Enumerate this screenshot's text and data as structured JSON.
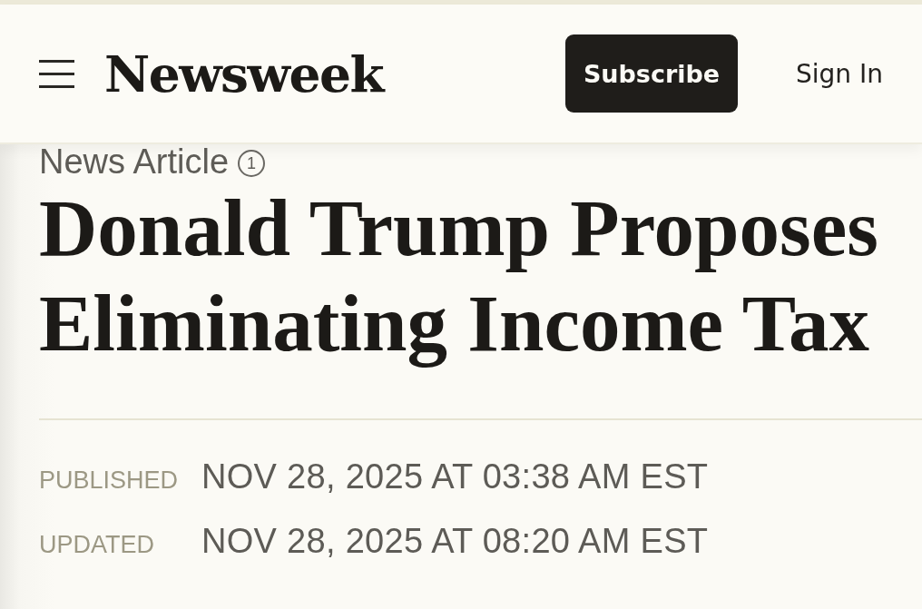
{
  "header": {
    "logo": "Newsweek",
    "subscribe_button": "Subscribe",
    "sign_in_link": "Sign In"
  },
  "article": {
    "label": "News Article",
    "label_badge": "1",
    "headline": "Donald Trump Proposes Eliminating Income Tax",
    "dates": [
      {
        "label": "PUBLISHED",
        "value": "NOV 28, 2025 AT 03:38 AM EST"
      },
      {
        "label": "UPDATED",
        "value": "NOV 28, 2025 AT 08:20 AM EST"
      }
    ]
  }
}
